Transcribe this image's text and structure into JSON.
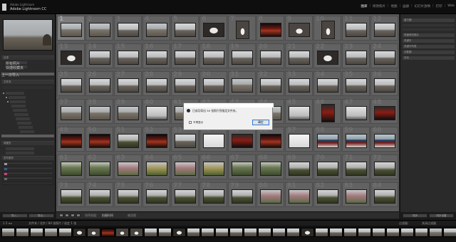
{
  "app": {
    "logo_line1": "Adobe Lightroom",
    "logo_line2": "Adobe Lightroom CC"
  },
  "modules": [
    "图库",
    "修改照片",
    "地图",
    "画册",
    "幻灯片放映",
    "打印",
    "Web"
  ],
  "left_panel": {
    "sections": [
      "导航器",
      "目录",
      "文件夹",
      "收藏夹",
      "发布服务"
    ],
    "catalog_items": [
      "所有照片",
      "快捷收藏夹",
      "上一次导入"
    ],
    "buttons": [
      "导入...",
      "导出..."
    ]
  },
  "grid": {
    "start_number": 1,
    "selected_index": 0,
    "rows": [
      [
        "wall",
        "wall",
        "mtn",
        "wall",
        "mtn",
        "arch",
        "gate",
        "red",
        "gate",
        "gate",
        "mtn",
        "mtn"
      ],
      [
        "arch",
        "mtn",
        "mtn",
        "mtn",
        "mtn",
        "mtn",
        "mtn",
        "mtn",
        "mtn",
        "arch",
        "mtn",
        "mtn"
      ],
      [
        "mtn",
        "mtn",
        "mtn",
        "mtn",
        "mtn",
        "mtn",
        "wall",
        "mtn",
        "mtn",
        "mtn",
        "mtn",
        "mtn"
      ],
      [
        "wall",
        "wall",
        "wall",
        "sky",
        "wall",
        "wall",
        "wall",
        "wall",
        "sky",
        "temple",
        "sky",
        "temple"
      ],
      [
        "red",
        "red",
        "tree",
        "red",
        "mtn",
        "white",
        "temple",
        "red",
        "white",
        "heaven",
        "heaven",
        "heaven"
      ],
      [
        "green",
        "green",
        "pink",
        "yellow",
        "pink",
        "yellow",
        "green",
        "green",
        "tree",
        "tree",
        "tree",
        "tree"
      ],
      [
        "tree",
        "tree",
        "tree",
        "tree",
        "tree",
        "tree",
        "tree",
        "pink",
        "pink",
        "tree",
        "pink",
        "tree"
      ]
    ]
  },
  "dialog": {
    "message": "已成功导出 50 张照片到指定文件夹。",
    "checkbox_label": "不再显示",
    "ok_label": "确定"
  },
  "right_panel": {
    "rows": [
      "直方图",
      "快速修改照片",
      "关键字",
      "关键字列表",
      "元数据",
      "评论"
    ],
    "buttons": [
      "同步",
      "同步设置"
    ]
  },
  "toolbar": {
    "sort_label": "排序依据：",
    "sort_value": "拍摄时间",
    "thumbs_label": "缩览图"
  },
  "filmstrip_header": {
    "path": "文件夹 / 北京 / 84 张照片 / 选定 1 张",
    "filter_label": "过滤器：",
    "filter_value": "关闭过滤器"
  }
}
